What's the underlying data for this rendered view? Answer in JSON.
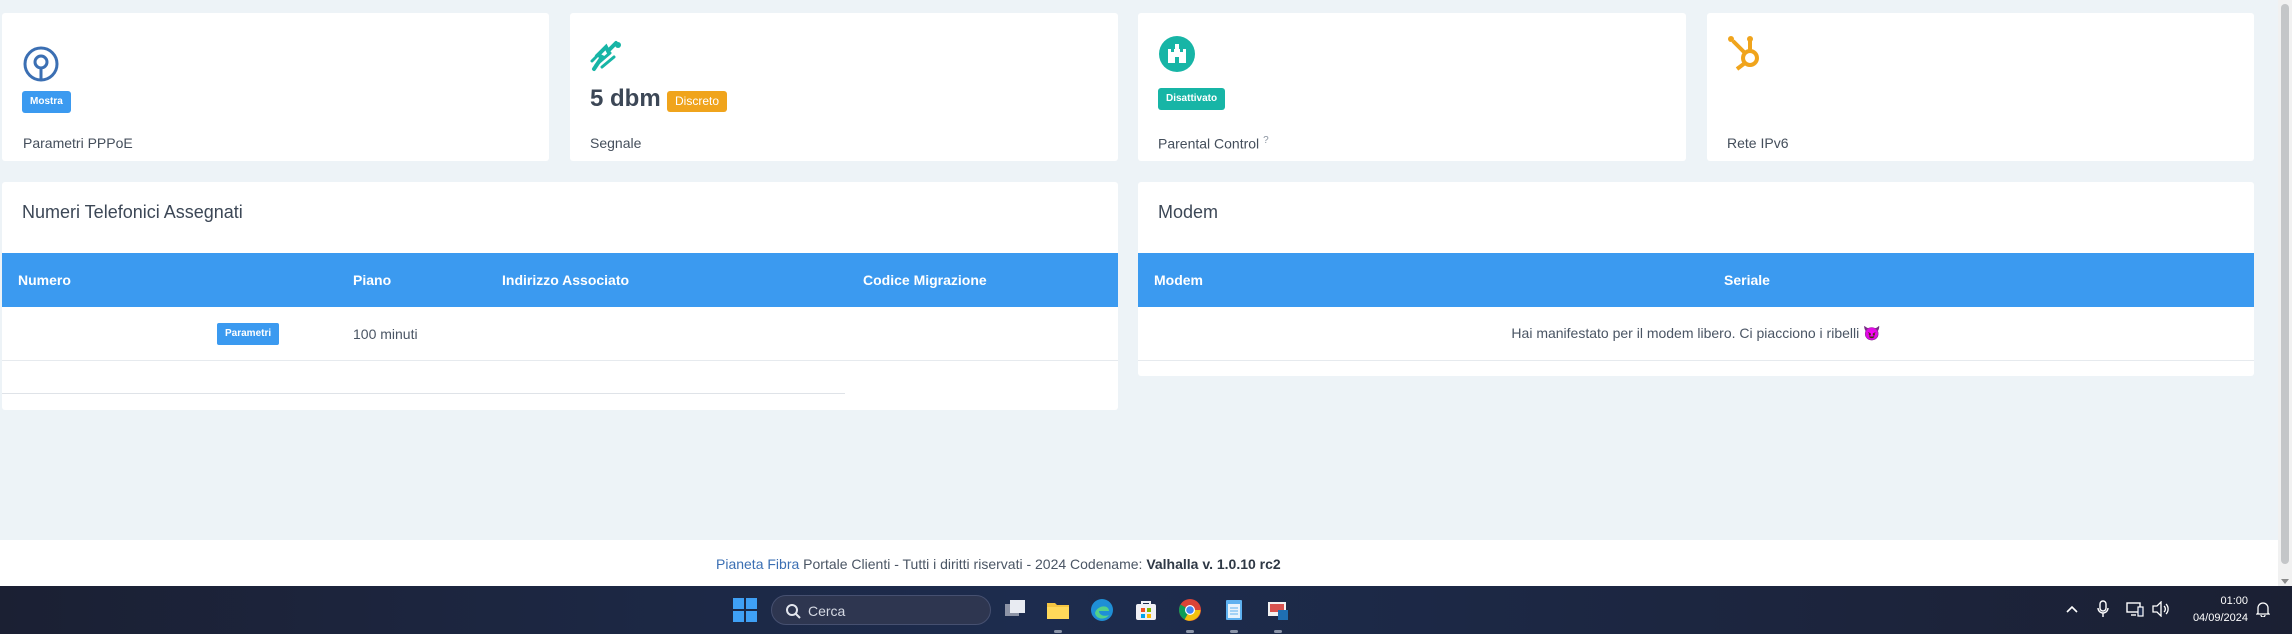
{
  "stats": [
    {
      "badge": "Mostra",
      "label": "Parametri PPPoE",
      "icon": "openwrt-icon"
    },
    {
      "value": "5 dbm",
      "badge": "Discreto",
      "label": "Segnale",
      "icon": "signal-dish-icon"
    },
    {
      "badge": "Disattivato",
      "label": "Parental Control",
      "help": "?",
      "icon": "castle-icon"
    },
    {
      "label": "Rete IPv6",
      "icon": "hubspot-network-icon"
    }
  ],
  "phones": {
    "title": "Numeri Telefonici Assegnati",
    "columns": [
      "Numero",
      "Piano",
      "Indirizzo Associato",
      "Codice Migrazione"
    ],
    "rows": [
      {
        "button": "Parametri",
        "piano": "100 minuti",
        "indirizzo": "",
        "codice": ""
      }
    ]
  },
  "modem": {
    "title": "Modem",
    "columns": [
      "Modem",
      "Seriale"
    ],
    "message": "Hai manifestato per il modem libero. Ci piacciono i ribelli",
    "emoji": "😈"
  },
  "footer": {
    "brand": "Pianeta Fibra",
    "text": " Portale Clienti - Tutti i diritti riservati - 2024 Codename: ",
    "codename": "Valhalla v. 1.0.10 rc2"
  },
  "taskbar": {
    "search_placeholder": "Cerca",
    "time": "01:00",
    "date": "04/09/2024"
  },
  "colors": {
    "accent": "#3b9af0",
    "teal": "#17b5a6",
    "orange": "#f0a41c",
    "background": "#edf3f7"
  }
}
